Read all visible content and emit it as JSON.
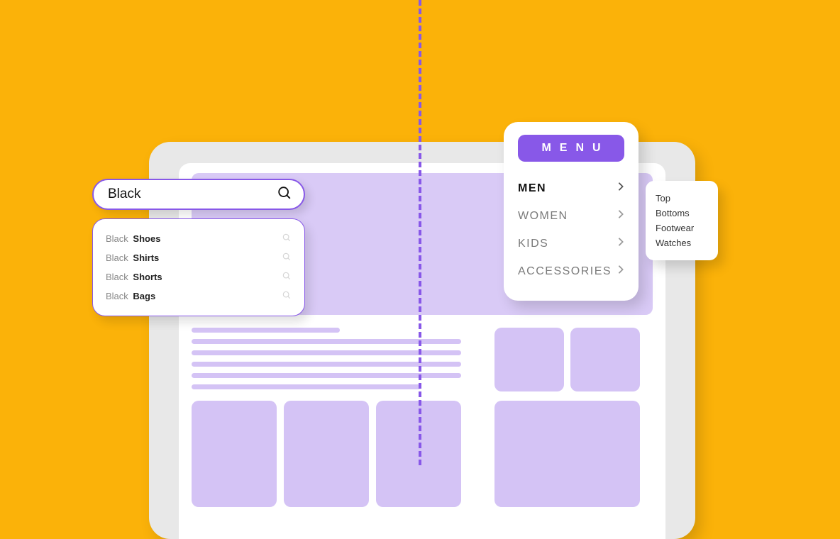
{
  "search": {
    "query": "Black",
    "suggestions": [
      {
        "prefix": "Black",
        "rest": "Shoes"
      },
      {
        "prefix": "Black",
        "rest": "Shirts"
      },
      {
        "prefix": "Black",
        "rest": "Shorts"
      },
      {
        "prefix": "Black",
        "rest": "Bags"
      }
    ]
  },
  "menu": {
    "title": "MENU",
    "items": [
      {
        "label": "MEN",
        "active": true
      },
      {
        "label": "WOMEN",
        "active": false
      },
      {
        "label": "KIDS",
        "active": false
      },
      {
        "label": "ACCESSORIES",
        "active": false
      }
    ]
  },
  "submenu": {
    "items": [
      "Top",
      "Bottoms",
      "Footwear",
      "Watches"
    ]
  }
}
